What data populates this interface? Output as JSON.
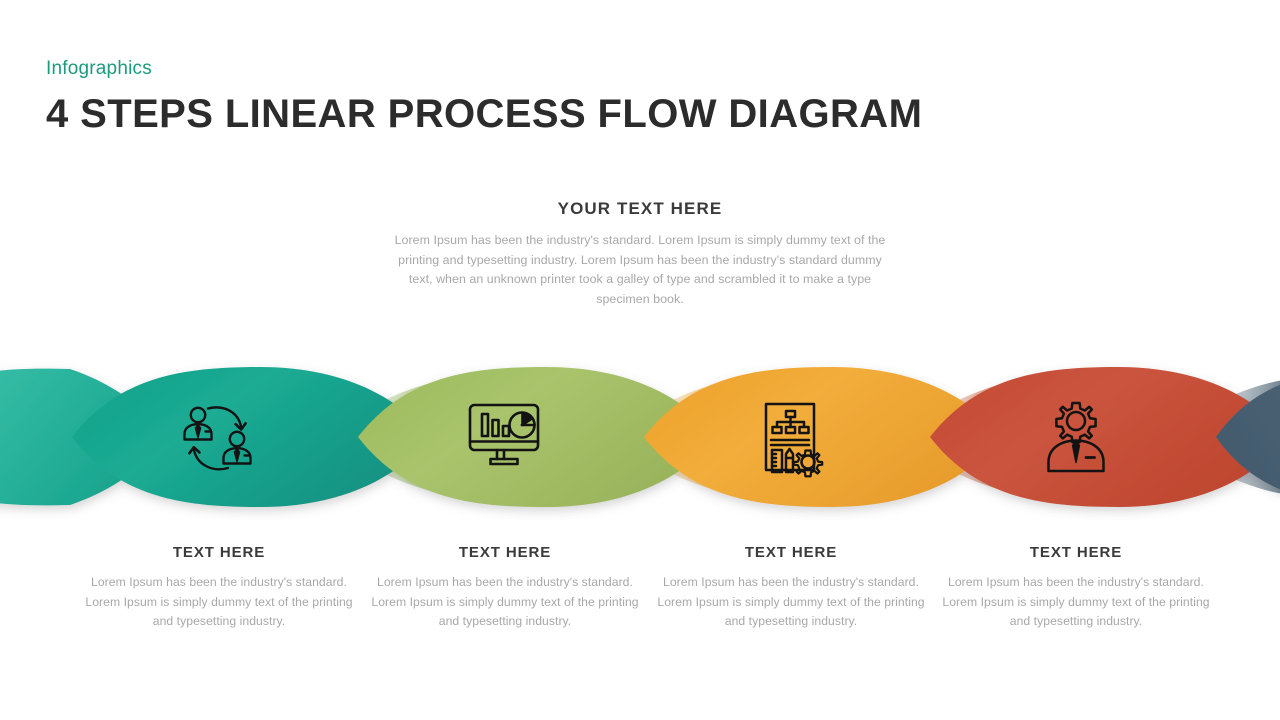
{
  "header": {
    "eyebrow": "Infographics",
    "title": "4 STEPS LINEAR PROCESS FLOW DIAGRAM"
  },
  "intro": {
    "title": "YOUR TEXT HERE",
    "body": "Lorem Ipsum has been the industry's standard. Lorem Ipsum is simply dummy text of the printing and typesetting industry. Lorem Ipsum has been the industry's standard dummy text, when an unknown printer took a galley of type and scrambled it to make a type specimen book."
  },
  "steps": [
    {
      "index": 1,
      "color": "#18a28c",
      "color_light": "#4ecbb4",
      "icon": "people-exchange-icon",
      "title": "TEXT HERE",
      "body": "Lorem Ipsum has been the industry's standard. Lorem Ipsum is simply dummy text of the printing and typesetting industry."
    },
    {
      "index": 2,
      "color": "#a3bf62",
      "color_light": "#c2d68e",
      "icon": "monitor-analytics-icon",
      "title": "TEXT HERE",
      "body": "Lorem Ipsum has been the industry's standard. Lorem Ipsum is simply dummy text of the printing and typesetting industry."
    },
    {
      "index": 3,
      "color": "#efa833",
      "color_light": "#f5c878",
      "icon": "blueprint-tools-icon",
      "title": "TEXT HERE",
      "body": "Lorem Ipsum has been the industry's standard. Lorem Ipsum is simply dummy text of the printing and typesetting industry."
    },
    {
      "index": 4,
      "color": "#c8503a",
      "color_light": "#dd8066",
      "icon": "gear-head-person-icon",
      "title": "TEXT HERE",
      "body": "Lorem Ipsum has been the industry's standard. Lorem Ipsum is simply dummy text of the printing and typesetting industry."
    }
  ],
  "edge_segments": {
    "left_color": "#3ec4ad",
    "right_color": "#4a6274"
  },
  "palette": {
    "accent_teal": "#1a9b7c",
    "title_dark": "#2c2c2c",
    "body_gray": "#a8a8a8",
    "background": "#ffffff"
  }
}
